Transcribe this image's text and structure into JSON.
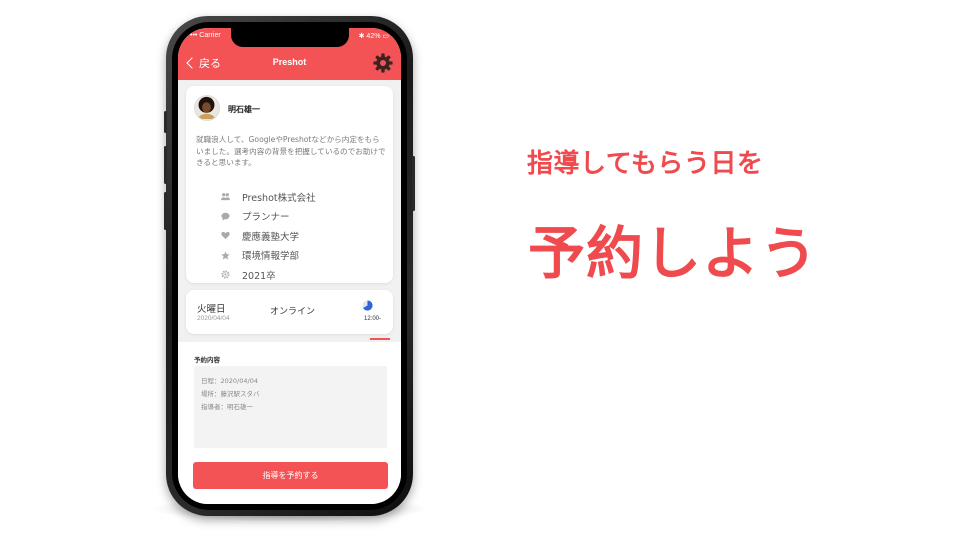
{
  "status_bar": {
    "carrier": "••• Carrier",
    "battery": "✱ 42% ▭"
  },
  "header": {
    "back_label": "戻る",
    "title": "Preshot"
  },
  "profile": {
    "name": "明石雄一",
    "intro": "就職浪人して、GoogleやPreshotなどから内定をもらいました。選考内容の背景を把握しているのでお助けできると思います。",
    "attributes": [
      {
        "icon": "people-icon",
        "text": "Preshot株式会社"
      },
      {
        "icon": "chat-bubble-icon",
        "text": "プランナー"
      },
      {
        "icon": "heart-icon",
        "text": "慶應義塾大学"
      },
      {
        "icon": "star-icon",
        "text": "環境情報学部"
      },
      {
        "icon": "gear-icon",
        "text": "2021卒"
      }
    ]
  },
  "schedule": {
    "day": "火曜日",
    "date": "2020/04/04",
    "mode": "オンライン",
    "time": "12:00-"
  },
  "reservation": {
    "title": "予約内容",
    "lines": [
      "日程：2020/04/04",
      "場所：藤沢駅スタバ",
      "指導者：明石雄一"
    ],
    "button_label": "指導を予約する"
  },
  "promo": {
    "line1": "指導してもらう日を",
    "line2": "予約しよう"
  },
  "colors": {
    "accent": "#f45356",
    "headline": "#ef4b4f"
  }
}
